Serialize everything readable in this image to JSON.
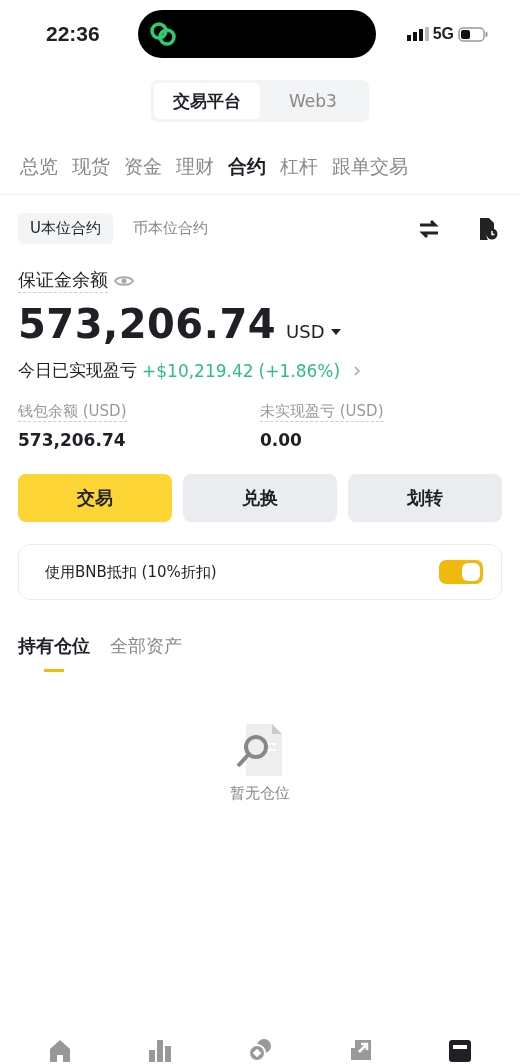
{
  "status_bar": {
    "time": "22:36",
    "network": "5G"
  },
  "platform_tabs": [
    {
      "label": "交易平台",
      "selected": true
    },
    {
      "label": "Web3",
      "selected": false
    }
  ],
  "section_tabs": [
    {
      "label": "总览",
      "selected": false
    },
    {
      "label": "现货",
      "selected": false
    },
    {
      "label": "资金",
      "selected": false
    },
    {
      "label": "理财",
      "selected": false
    },
    {
      "label": "合约",
      "selected": true
    },
    {
      "label": "杠杆",
      "selected": false
    },
    {
      "label": "跟单交易",
      "selected": false
    }
  ],
  "contract_tabs": [
    {
      "label": "U本位合约",
      "selected": true
    },
    {
      "label": "币本位合约",
      "selected": false
    }
  ],
  "margin": {
    "label": "保证金余额",
    "amount": "573,206.74",
    "currency": "USD",
    "pnl_label": "今日已实现盈亏",
    "pnl_value": "+$10,219.42",
    "pnl_percent": "(+1.86%)"
  },
  "stats": [
    {
      "label": "钱包余额 (USD)",
      "value": "573,206.74"
    },
    {
      "label": "未实现盈亏 (USD)",
      "value": "0.00"
    }
  ],
  "actions": [
    {
      "label": "交易",
      "kind": "primary"
    },
    {
      "label": "兑换",
      "kind": "secondary"
    },
    {
      "label": "划转",
      "kind": "secondary"
    }
  ],
  "bnb_toggle": {
    "label": "使用BNB抵扣 (10%折扣)",
    "on": true
  },
  "position_tabs": [
    {
      "label": "持有仓位",
      "selected": true
    },
    {
      "label": "全部资产",
      "selected": false
    }
  ],
  "empty_state": {
    "text": "暂无仓位"
  },
  "bottom_nav": [
    {
      "kind": "home",
      "selected": false
    },
    {
      "kind": "markets",
      "selected": false
    },
    {
      "kind": "trade",
      "selected": false
    },
    {
      "kind": "futures",
      "selected": false
    },
    {
      "kind": "wallet",
      "selected": true
    }
  ]
}
